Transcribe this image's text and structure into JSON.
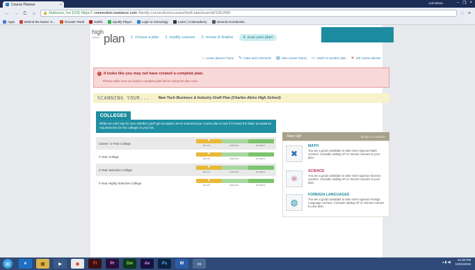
{
  "browser": {
    "tab_title": "Course Planner",
    "tab_close": "×",
    "profile": "Johnathan",
    "window_controls": [
      "–",
      "❐",
      "×"
    ],
    "nav": [
      "←",
      "→",
      "C",
      "⌂"
    ],
    "secure_org": "Hobsons, Inc [US]",
    "url_scheme": "https://",
    "url_host": "connection.naviance.com",
    "url_path": "/family-connection/courses/draft-plan/scan/id/1061968",
    "star_icon": "☆",
    "menu_icon": "≡",
    "bookmarks": [
      {
        "label": "Apps",
        "color": "#4a7bd0"
      },
      {
        "label": "Behind the Name: K...",
        "color": "#c73f3f"
      },
      {
        "label": "Rooster Teeth",
        "color": "#d1541c"
      },
      {
        "label": "Netflix",
        "color": "#c0141b"
      },
      {
        "label": "Spotify Player",
        "color": "#2fb14d"
      },
      {
        "label": "Login to Schoology",
        "color": "#2c7fc9"
      },
      {
        "label": "Learn | Codecademy",
        "color": "#333333"
      },
      {
        "label": "General Gundam/M...",
        "color": "#555555"
      }
    ]
  },
  "app": {
    "logo": {
      "high": "high",
      "school": "school",
      "plan": "plan"
    },
    "steps": [
      {
        "label": "1. choose a plan",
        "active": false
      },
      {
        "label": "2. modify courses",
        "active": false
      },
      {
        "label": "3. review & finalize",
        "active": false
      },
      {
        "label": "4. scan your plan!",
        "active": true
      }
    ],
    "links": [
      {
        "label": "course planner home",
        "icon": "⌂",
        "color": "#e07b1a"
      },
      {
        "label": "notes and comments",
        "icon": "✎",
        "color": "#2d7fb8"
      },
      {
        "label": "view course history",
        "icon": "▤",
        "color": "#2d7fb8"
      },
      {
        "label": "switch to another plan",
        "icon": "▭",
        "color": "#2d7fb8"
      },
      {
        "label": "exit course planner",
        "icon": "✕",
        "color": "#c43a3a"
      }
    ],
    "alert": {
      "icon": "!",
      "title": "It looks like you may not have created a complete plan.",
      "body": "Please make sure you build a complete plan before using the plan scan."
    },
    "scanning": {
      "label": "SCANNING YOUR...",
      "plan_name": "New Tech Business & Industry Draft Plan (Charles Akins High School)"
    },
    "colleges": {
      "heading": "COLLEGES",
      "description": "While we can't say for sure whether you'll get accepted, we've scanned your course plan to see if it meets the basic acceptance requirements for the colleges in your list.",
      "bar_labels": [
        "BELOW",
        "AVERAGE",
        "EXCEEDS"
      ],
      "rows": [
        {
          "label": "Career / 2-Year College"
        },
        {
          "label": "4-Year College"
        },
        {
          "label": "4-Year Selective College"
        },
        {
          "label": "4-Year Highly Selective College"
        }
      ]
    },
    "step_up": {
      "title": "Step Up!",
      "subtitle": "things to consider",
      "subjects": [
        {
          "title": "MATH",
          "color": "#1d8ca0",
          "icon": "✖",
          "icon_color": "#2d6fb8",
          "text": "You are a good candidate to take more rigorous Math courses. Consider adding AP or Honors courses to your plan."
        },
        {
          "title": "SCIENCE",
          "color": "#c0356a",
          "icon": "⚛",
          "icon_color": "#b0306a",
          "text": "You are a good candidate to take more rigorous Science courses. Consider adding AP or Honors courses to your plan."
        },
        {
          "title": "FOREIGN LANGUAGES",
          "color": "#1d8ca0",
          "icon": "◍",
          "icon_color": "#1d8ca0",
          "text": "You are a good candidate to take more rigorous Foreign Language courses. Consider adding AP or Honors courses to your plan."
        }
      ]
    }
  },
  "taskbar": {
    "start_icon": "⊞",
    "apps": [
      {
        "label": "e",
        "bg": "#1e6fc4",
        "fg": "#ffffff",
        "name": "ie-icon"
      },
      {
        "label": "▤",
        "bg": "#d9b24a",
        "fg": "#5a3b00",
        "name": "file-explorer-icon"
      },
      {
        "label": "▶",
        "bg": "#3a5a88",
        "fg": "#ffffff",
        "name": "media-player-icon"
      },
      {
        "label": "◉",
        "bg": "#e9e9e9",
        "fg": "#d93b2b",
        "name": "chrome-icon"
      },
      {
        "label": "Fl",
        "bg": "#3b1010",
        "fg": "#ff4a4a",
        "name": "flash-icon"
      },
      {
        "label": "Pr",
        "bg": "#2a0f3a",
        "fg": "#e29cff",
        "name": "premiere-icon"
      },
      {
        "label": "Dw",
        "bg": "#0f3a1a",
        "fg": "#8fe05f",
        "name": "dreamweaver-icon"
      },
      {
        "label": "Ae",
        "bg": "#1a1040",
        "fg": "#c7a2ff",
        "name": "after-effects-icon"
      },
      {
        "label": "Ps",
        "bg": "#0b2340",
        "fg": "#4cb0ff",
        "name": "photoshop-icon"
      },
      {
        "label": "W",
        "bg": "#2b5ca8",
        "fg": "#ffffff",
        "name": "word-icon"
      },
      {
        "label": "▭",
        "bg": "#4b6a94",
        "fg": "#ffffff",
        "name": "app-window-icon"
      }
    ],
    "tray": {
      "icons": "▴ ▮ ◀)",
      "time": "12:36 PM",
      "date": "10/21/2015"
    }
  }
}
